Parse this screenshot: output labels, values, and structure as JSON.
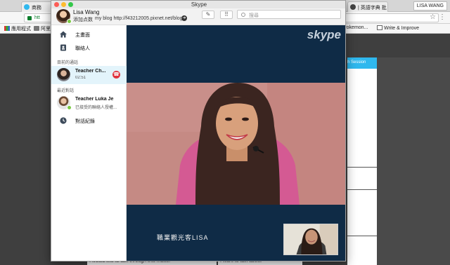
{
  "browser": {
    "tabs": [
      {
        "label": "商務"
      },
      {
        "label": "| 英語字典 批"
      }
    ],
    "profile_name": "LISA WANG",
    "address": "htt",
    "bookmarks": [
      {
        "label": "應用程式",
        "icon": "apps-grid-icon"
      },
      {
        "label": "阿里",
        "icon": "folder-icon"
      },
      {
        "label": "Pokemon...",
        "icon": "page-icon"
      },
      {
        "label": "Write & Improve",
        "icon": "page-icon"
      }
    ],
    "page_panel_header": "h Session",
    "bottom_texts": [
      "I would like to talk through this matter",
      "I want to talk about"
    ]
  },
  "skype": {
    "window_title": "Skype",
    "header": {
      "user_name": "Lisa Wang",
      "mood": "添加点数",
      "blog": "my blog  http://f43212005.pixnet.net/blog",
      "search_placeholder": "搜尋"
    },
    "nav": {
      "home": "主畫面",
      "contacts": "聯絡人",
      "history": "對話紀錄"
    },
    "sections": {
      "current": "目前的通話",
      "recent": "最近對話"
    },
    "active_call": {
      "name": "Teacher Ch...",
      "duration": "02:51"
    },
    "recent_contact": {
      "name": "Teacher Luka Je",
      "preview": "已接受的聯絡人授權..."
    },
    "call": {
      "watermark": "skype",
      "caption": "職業觀光客LISA"
    },
    "colors": {
      "call_bg": "#0f2b46",
      "hangup": "#e0333e",
      "online": "#7ac943",
      "accent": "#2fb8ee"
    }
  }
}
